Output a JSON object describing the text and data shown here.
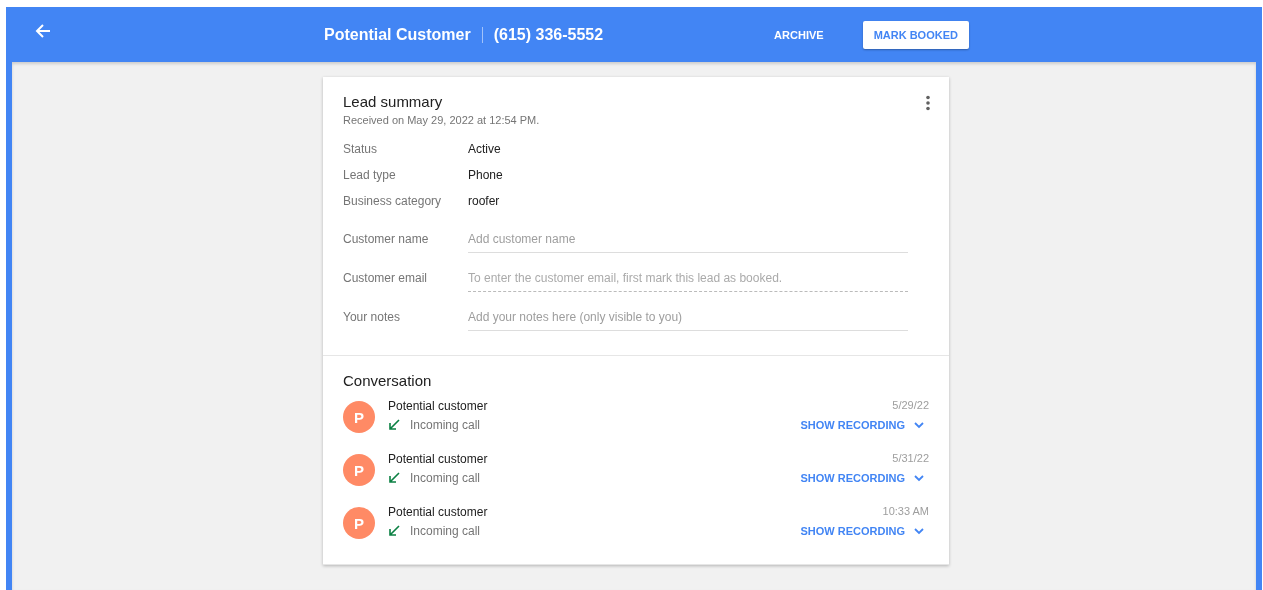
{
  "header": {
    "title": "Potential Customer",
    "phone": "(615) 336-5552",
    "actions": [
      {
        "label": "ARCHIVE",
        "kind": "text"
      },
      {
        "label": "MARK BOOKED",
        "kind": "raised"
      }
    ]
  },
  "summary": {
    "title": "Lead summary",
    "received": "Received on May 29, 2022 at 12:54 PM.",
    "details": [
      {
        "label": "Status",
        "value": "Active"
      },
      {
        "label": "Lead type",
        "value": "Phone"
      },
      {
        "label": "Business category",
        "value": "roofer"
      }
    ],
    "fields": [
      {
        "label": "Customer name",
        "placeholder": "Add customer name",
        "disabled": false
      },
      {
        "label": "Customer email",
        "placeholder": "To enter the customer email, first mark this lead as booked.",
        "disabled": true
      },
      {
        "label": "Your notes",
        "placeholder": "Add your notes here (only visible to you)",
        "disabled": false
      }
    ]
  },
  "conversation": {
    "title": "Conversation",
    "items": [
      {
        "avatar": "P",
        "name": "Potential customer",
        "type": "Incoming call",
        "time": "5/29/22",
        "action": "SHOW RECORDING"
      },
      {
        "avatar": "P",
        "name": "Potential customer",
        "type": "Incoming call",
        "time": "5/31/22",
        "action": "SHOW RECORDING"
      },
      {
        "avatar": "P",
        "name": "Potential customer",
        "type": "Incoming call",
        "time": "10:33 AM",
        "action": "SHOW RECORDING"
      }
    ]
  }
}
